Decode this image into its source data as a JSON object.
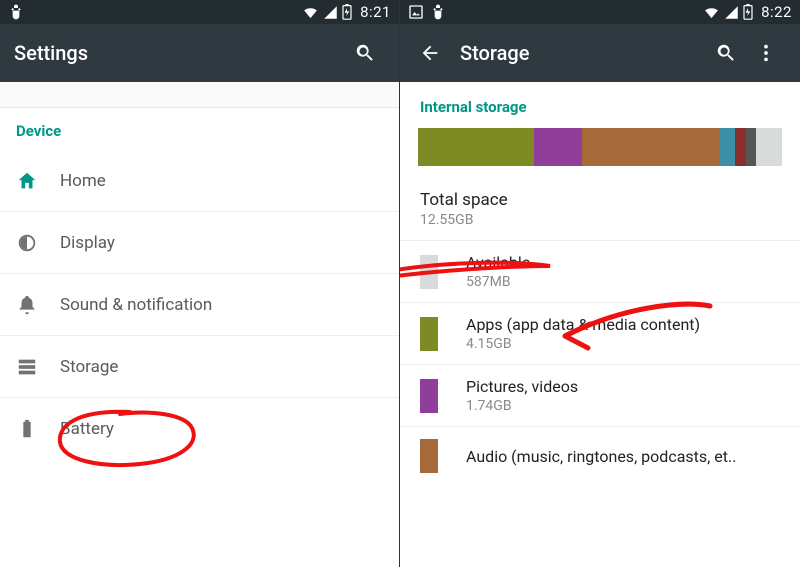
{
  "left": {
    "status": {
      "time": "8:21"
    },
    "appbar": {
      "title": "Settings"
    },
    "section": "Device",
    "items": [
      {
        "key": "home",
        "label": "Home"
      },
      {
        "key": "display",
        "label": "Display"
      },
      {
        "key": "sound",
        "label": "Sound & notification"
      },
      {
        "key": "storage",
        "label": "Storage"
      },
      {
        "key": "battery",
        "label": "Battery"
      }
    ]
  },
  "right": {
    "status": {
      "time": "8:22"
    },
    "appbar": {
      "title": "Storage"
    },
    "section": "Internal storage",
    "total": {
      "label": "Total space",
      "value": "12.55GB"
    },
    "segments": [
      {
        "key": "apps",
        "pct": 32,
        "class": "seg-apps"
      },
      {
        "key": "pics",
        "pct": 13,
        "class": "seg-pics"
      },
      {
        "key": "audio",
        "pct": 38,
        "class": "seg-audio"
      },
      {
        "key": "dl",
        "pct": 4,
        "class": "seg-dl"
      },
      {
        "key": "cache",
        "pct": 3,
        "class": "seg-cache"
      },
      {
        "key": "misc",
        "pct": 3,
        "class": "seg-misc"
      },
      {
        "key": "free",
        "pct": 7,
        "class": "seg-free"
      }
    ],
    "rows": [
      {
        "key": "available",
        "swatch": "#d7dbdb",
        "title": "Available",
        "sub": "587MB"
      },
      {
        "key": "apps",
        "swatch": "#7e8b25",
        "title": "Apps (app data & media content)",
        "sub": "4.15GB"
      },
      {
        "key": "pics",
        "swatch": "#8f3f9a",
        "title": "Pictures, videos",
        "sub": "1.74GB"
      },
      {
        "key": "audio",
        "swatch": "#a5693a",
        "title": "Audio (music, ringtones, podcasts, et..",
        "sub": ""
      }
    ]
  }
}
